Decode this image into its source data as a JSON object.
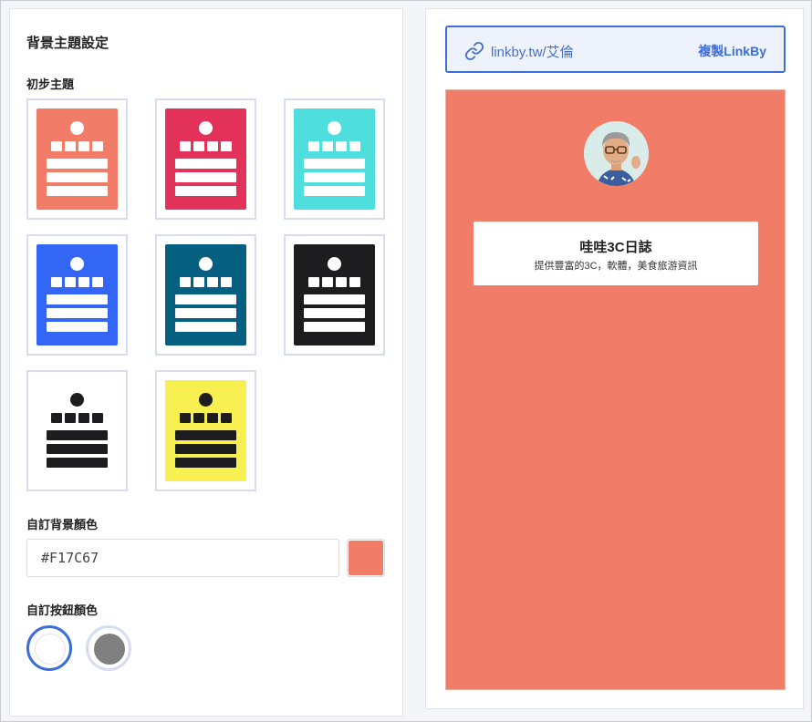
{
  "left": {
    "title": "背景主題設定",
    "themes_label": "初步主題",
    "themes": [
      {
        "name": "salmon",
        "bg": "#F17C67",
        "fg": "#FFFFFF"
      },
      {
        "name": "crimson",
        "bg": "#E3325A",
        "fg": "#FFFFFF"
      },
      {
        "name": "turquoise",
        "bg": "#4FDEDE",
        "fg": "#FFFFFF"
      },
      {
        "name": "blue",
        "bg": "#3466F6",
        "fg": "#FFFFFF"
      },
      {
        "name": "teal",
        "bg": "#045F80",
        "fg": "#FFFFFF"
      },
      {
        "name": "black",
        "bg": "#1D1D1F",
        "fg": "#FFFFFF"
      },
      {
        "name": "white",
        "bg": "#FFFFFF",
        "fg": "#1D1D1F"
      },
      {
        "name": "yellow",
        "bg": "#F8F050",
        "fg": "#1D1D1F"
      }
    ],
    "bg_color_label": "自訂背景顏色",
    "bg_color_value": "#F17C67",
    "button_color_label": "自訂按鈕顏色",
    "button_colors": [
      {
        "name": "white",
        "color": "#FFFFFF",
        "ring": "#3D6DDB",
        "selected": true
      },
      {
        "name": "gray",
        "color": "#808080",
        "ring": "#D6DDF0",
        "selected": false
      }
    ]
  },
  "right": {
    "link_icon": "link-icon",
    "link_text": "linkby.tw/艾倫",
    "copy_label": "複製LinkBy",
    "preview_bg": "#F17C67",
    "profile": {
      "avatar": "memoji-avatar",
      "name": "哇哇3C日誌",
      "description": "提供豐富的3C，軟體，美食旅游資訊"
    }
  },
  "colors": {
    "accent": "#3D6DDB"
  }
}
